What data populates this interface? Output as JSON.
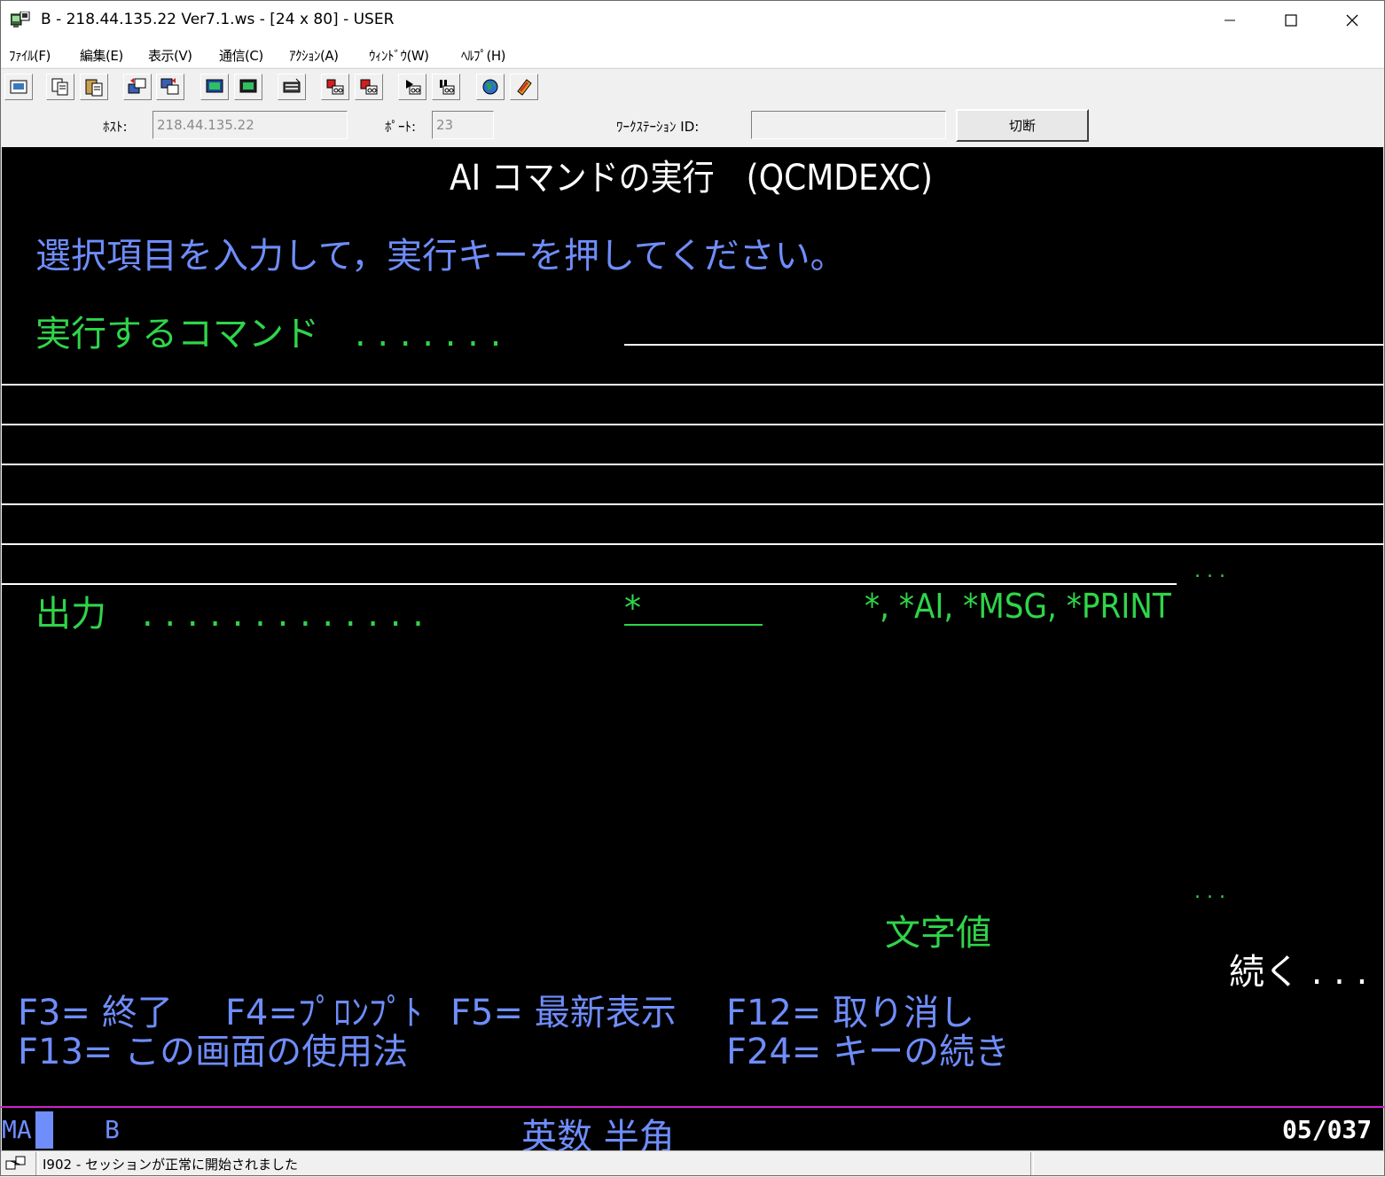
{
  "window": {
    "title": "B - 218.44.135.22 Ver7.1.ws - [24 x 80] - USER"
  },
  "menu": [
    {
      "label": "ﾌｧｲﾙ(F)"
    },
    {
      "label": "編集(E)"
    },
    {
      "label": "表示(V)"
    },
    {
      "label": "通信(C)"
    },
    {
      "label": "ｱｸｼｮﾝ(A)"
    },
    {
      "label": "ｳｨﾝﾄﾞｳ(W)"
    },
    {
      "label": "ﾍﾙﾌﾟ(H)"
    }
  ],
  "toolbar": {
    "icons": [
      "print-screen-icon",
      "copy-icon",
      "paste-icon",
      "send-file-icon",
      "receive-file-icon",
      "display-setup-icon",
      "keyboard-setup-icon",
      "macro-icon",
      "record-macro-icon",
      "stop-macro-icon",
      "play-macro-icon",
      "pause-macro-icon",
      "globe-icon",
      "help-book-icon"
    ]
  },
  "connection": {
    "host_label": "ﾎｽﾄ:",
    "host_value": "218.44.135.22",
    "port_label": "ﾎﾟｰﾄ:",
    "port_value": "23",
    "workstation_label": "ﾜｰｸｽﾃｰｼｮﾝ ID:",
    "workstation_value": "",
    "disconnect_label": "切断"
  },
  "terminal": {
    "title": "AI コマンドの実行　(QCMDEXC)",
    "instruction": "選択項目を入力して，実行キーを押してください。",
    "command_label": "実行するコマンド　. . . . . . .",
    "command_more": ". . .",
    "output_label": "出力　. . . . . . . . . . . . .",
    "output_value": "*",
    "output_choices": "*, *AI, *MSG, *PRINT",
    "values_more": ". . .",
    "char_value_label": "文字値",
    "more_indicator": "続く . . .",
    "fkeys_row1": [
      {
        "key": "F3=",
        "text": "終了"
      },
      {
        "key": "F4=",
        "text": "ﾌﾟﾛﾝﾌﾟﾄ"
      },
      {
        "key": "F5=",
        "text": "最新表示"
      },
      {
        "key": "F12=",
        "text": "取り消し"
      }
    ],
    "fkeys_row2": [
      {
        "key": "F13=",
        "text": "この画面の使用法"
      },
      {
        "key": "F24=",
        "text": "キーの続き"
      }
    ]
  },
  "oia": {
    "indicator": "MA",
    "session": "B",
    "input_mode": "英数 半角",
    "cursor_pos": "05/037"
  },
  "statusbar": {
    "message": "I902 - セッションが正常に開始されました"
  }
}
